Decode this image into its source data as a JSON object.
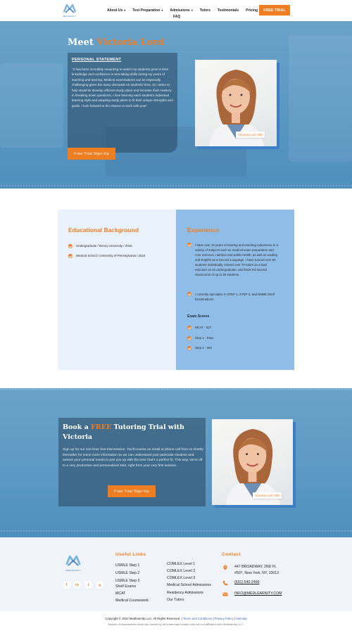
{
  "header": {
    "logo_text": "MEDLEARNITY",
    "nav": [
      {
        "label": "About Us",
        "has_dropdown": true
      },
      {
        "label": "Test Preparation",
        "has_dropdown": true
      },
      {
        "label": "Admissions",
        "has_dropdown": true
      },
      {
        "label": "Tutors",
        "has_dropdown": false
      },
      {
        "label": "Testimonials",
        "has_dropdown": false
      },
      {
        "label": "Pricing",
        "has_dropdown": false
      }
    ],
    "nav_second_row": "FAQ",
    "cta": "FREE TRIAL"
  },
  "hero": {
    "title_prefix": "Meet ",
    "title_name": "Victoria Lord",
    "statement_heading": "PERSONAL STATEMENT",
    "statement_text": "\"It has been incredibly rewarding to watch my students grow in their knowledge and confidence in test-taking skills during my years of teaching and tutoring. Medical examinations can be especially challenging given the many demands on students' time, so I strive to help students develop efficient study plans and increase their mastery in breaking down questions. I love learning each student's individual learning style and adapting study plans to fit their unique strengths and goals. I look forward to the chance to work with you!\"",
    "photo_caption": "Victoria Lord, MD",
    "cta": "Free Trial Sign-Up"
  },
  "education": {
    "heading": "Educational Background",
    "items": [
      "Undergraduate / Emory University / 2016",
      "Medical School / University of Pennsylvania / 2024"
    ]
  },
  "experience": {
    "heading": "Experience",
    "items": [
      "I have over 10 years of tutoring and teaching experience in a variety of subjects such as medical exam preparation and core sciences, nutrition and public health, as well as reading and English as a Second Language. I have tutored over 50 students individually, trained over 70 tutors as a lead educator as an undergraduate, and have led several classrooms of up to 30 students.",
      "I currently specialize in STEP 1, STEP 2, and NMBE Shelf Examinations."
    ],
    "scores_heading": "Exam Scores",
    "scores": [
      "MCAT - 527",
      "Step 1 - Pass",
      "Step 2 - 283"
    ]
  },
  "trial": {
    "title_pre": "Book a ",
    "title_free": "FREE",
    "title_post": " Tutoring Trial with Victoria",
    "text": "Sign up for our one-hour free trial session. You'll receive an email or phone call from us shortly thereafter for some more information so we can understand your particular situation and assess your personal needs to pair you up with the tutor that's a perfect fit. This way, we're off to a very productive and personalized start, right from your very first session.",
    "cta": "Free Trial Sign-Up",
    "photo_caption": "Victoria Lord, MD"
  },
  "footer": {
    "logo_text": "MEDLEARNITY",
    "useful_links_heading": "Useful Links",
    "links_col1": [
      "USMLE Step 1",
      "USMLE Step 2",
      "USMLE Step 3",
      "Shelf Exams",
      "MCAT",
      "Medical Coursework"
    ],
    "links_col2": [
      "COMLEX Level 1",
      "COMLEX Level 2",
      "COMLEX Level 3",
      "Medical School Admissions",
      "Residency Admissions",
      "Our Tutors"
    ],
    "contact_heading": "Contact",
    "address_line1": "447 BROADWAY, 2ND FL",
    "address_line2": "#507, New York, NY, 10013",
    "phone": "(631) 540-2499",
    "email": "INFO@MEDLEARNITY.COM",
    "social": [
      "f",
      "in",
      "t",
      "ig"
    ]
  },
  "copyright": {
    "text": "Copyright © 2023 Medlearnity LLC. All Rights Reserved. | ",
    "terms": "Terms and Conditions",
    "sep1": " | ",
    "privacy": "Privacy Policy",
    "sep2": " | ",
    "sitemap": "Sitemap",
    "disclaimer": "Names of standardized tests are owned by the trademark holders and are not affiliated with Medlearnity LLC."
  },
  "colors": {
    "accent": "#ef7d22",
    "hero_blue": "#5b98c3",
    "exp_blue": "#8fbde8",
    "edu_bg": "#e9f1fa"
  }
}
